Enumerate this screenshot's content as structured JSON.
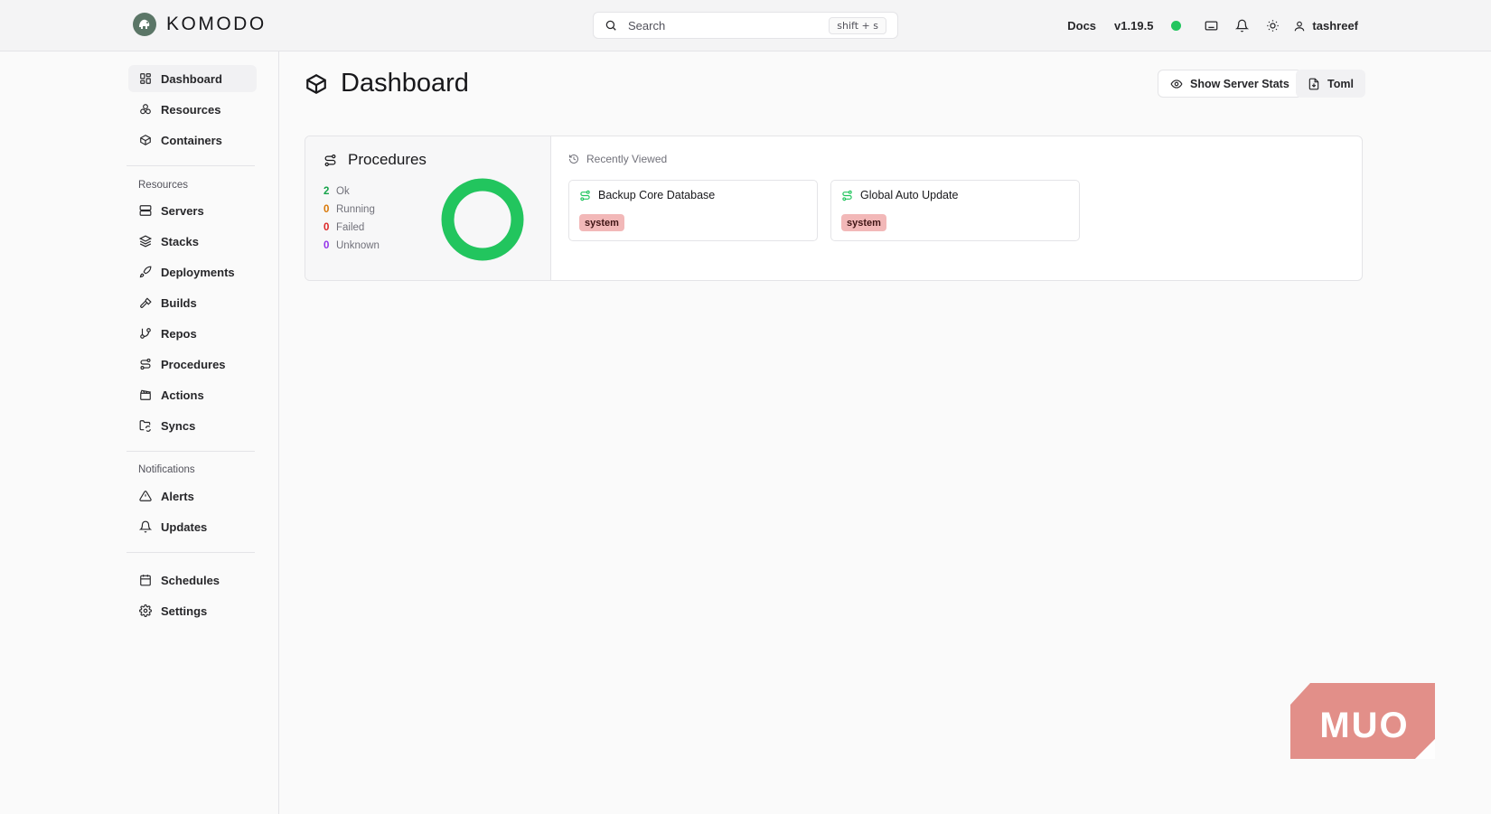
{
  "header": {
    "brand": "KOMODO",
    "search_placeholder": "Search",
    "search_shortcut": "shift + s",
    "docs_label": "Docs",
    "version": "v1.19.5",
    "status_color": "#22c55e",
    "username": "tashreef"
  },
  "sidebar": {
    "top_items": [
      {
        "label": "Dashboard",
        "icon": "dashboard-icon",
        "active": true
      },
      {
        "label": "Resources",
        "icon": "resources-icon"
      },
      {
        "label": "Containers",
        "icon": "box-icon"
      }
    ],
    "resources_heading": "Resources",
    "resource_items": [
      {
        "label": "Servers",
        "icon": "server-icon"
      },
      {
        "label": "Stacks",
        "icon": "layers-icon"
      },
      {
        "label": "Deployments",
        "icon": "rocket-icon"
      },
      {
        "label": "Builds",
        "icon": "hammer-icon"
      },
      {
        "label": "Repos",
        "icon": "git-branch-icon"
      },
      {
        "label": "Procedures",
        "icon": "route-icon"
      },
      {
        "label": "Actions",
        "icon": "clapperboard-icon"
      },
      {
        "label": "Syncs",
        "icon": "folder-sync-icon"
      }
    ],
    "notifications_heading": "Notifications",
    "notification_items": [
      {
        "label": "Alerts",
        "icon": "alert-triangle-icon"
      },
      {
        "label": "Updates",
        "icon": "bell-icon"
      }
    ],
    "bottom_items": [
      {
        "label": "Schedules",
        "icon": "calendar-icon"
      },
      {
        "label": "Settings",
        "icon": "settings-icon"
      }
    ]
  },
  "main": {
    "title": "Dashboard",
    "show_stats_label": "Show Server Stats",
    "toml_label": "Toml",
    "procedures": {
      "title": "Procedures",
      "stats": [
        {
          "count": "2",
          "label": "Ok",
          "color": "#16a34a"
        },
        {
          "count": "0",
          "label": "Running",
          "color": "#d97706"
        },
        {
          "count": "0",
          "label": "Failed",
          "color": "#dc2626"
        },
        {
          "count": "0",
          "label": "Unknown",
          "color": "#9333ea"
        }
      ],
      "donut_fraction_ok": 1.0,
      "donut_color": "#22c55e"
    },
    "recently_viewed": {
      "heading": "Recently Viewed",
      "items": [
        {
          "title": "Backup Core Database",
          "tag": "system"
        },
        {
          "title": "Global Auto Update",
          "tag": "system"
        }
      ]
    }
  },
  "watermark": {
    "text": "MUO",
    "color": "#e0857f"
  }
}
